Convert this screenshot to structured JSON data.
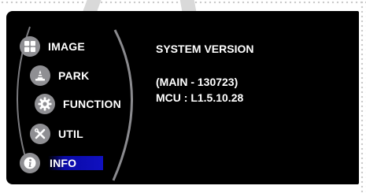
{
  "menu": {
    "items": [
      {
        "label": "IMAGE",
        "icon": "grid-icon"
      },
      {
        "label": "PARK",
        "icon": "traffic-cone-icon"
      },
      {
        "label": "FUNCTION",
        "icon": "gear-icon"
      },
      {
        "label": "UTIL",
        "icon": "tools-icon"
      },
      {
        "label": "INFO",
        "icon": "info-icon"
      }
    ],
    "selected_index": 4,
    "selected_color": "#1010c0"
  },
  "info": {
    "title": "SYSTEM VERSION",
    "main_version": "(MAIN - 130723)",
    "mcu_version": "MCU : L1.5.10.28"
  },
  "colors": {
    "screen_bg": "#000000",
    "icon_bg": "#8f8f93",
    "text": "#ffffff"
  }
}
